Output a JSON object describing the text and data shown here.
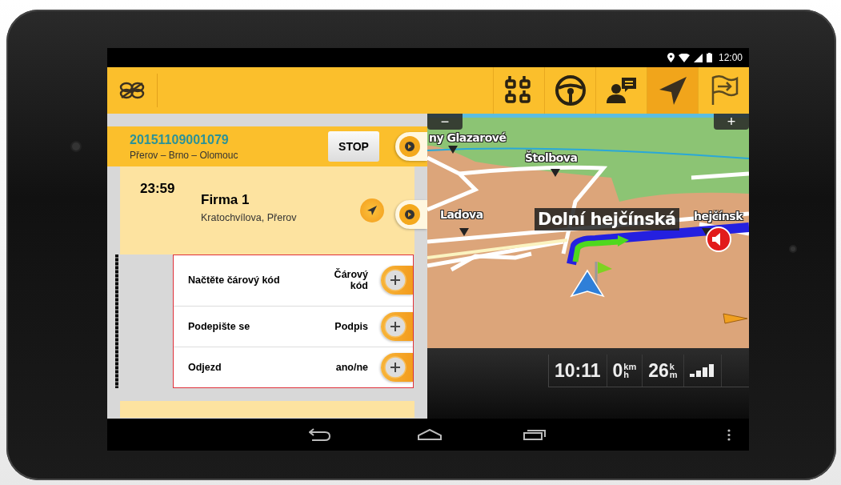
{
  "status_bar": {
    "time": "12:00"
  },
  "toolbar": {
    "tabs": [
      {
        "kind": "grid",
        "selected": false
      },
      {
        "kind": "wheel",
        "selected": false
      },
      {
        "kind": "chat",
        "selected": false
      },
      {
        "kind": "navigate",
        "selected": true
      },
      {
        "kind": "flag",
        "selected": false
      }
    ]
  },
  "order": {
    "number": "20151109001079",
    "route": "Přerov – Brno – Olomouc",
    "stop_button": "STOP"
  },
  "stop": {
    "time": "23:59",
    "name": "Firma 1",
    "address": "Kratochvílova, Přerov"
  },
  "tasks": [
    {
      "label": "Načtěte čárový kód",
      "action": "Čárový kód"
    },
    {
      "label": "Podepište se",
      "action": "Podpis"
    },
    {
      "label": "Odjezd",
      "action": "ano/ne"
    }
  ],
  "map": {
    "zoom_out": "−",
    "zoom_in": "+",
    "street_banner": "Dolní hejčínská",
    "labels": [
      {
        "text": "ny Glazarové"
      },
      {
        "text": "Štolbova"
      },
      {
        "text": "Ladova"
      },
      {
        "text": "hejčínsk"
      }
    ]
  },
  "dashboard": {
    "readouts": [
      {
        "value": "10:11"
      },
      {
        "value": "0",
        "unit_top": "km",
        "unit_bottom": "h"
      },
      {
        "value": "26",
        "unit_top": "k",
        "unit_bottom": "m"
      }
    ]
  }
}
